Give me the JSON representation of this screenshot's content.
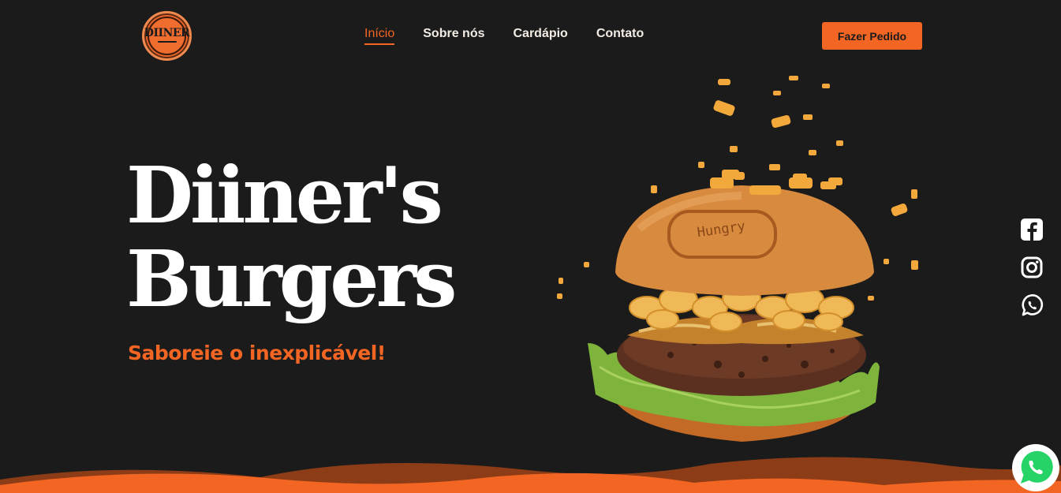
{
  "header": {
    "logo_text": "DIINER",
    "nav": [
      {
        "label": "Início",
        "active": true
      },
      {
        "label": "Sobre nós",
        "active": false
      },
      {
        "label": "Cardápio",
        "active": false
      },
      {
        "label": "Contato",
        "active": false
      }
    ],
    "cta_label": "Fazer Pedido"
  },
  "hero": {
    "title_line1": "Diiner's",
    "title_line2": "Burgers",
    "subtitle": "Saboreie o inexplicável!",
    "bun_stamp": "Hungry"
  },
  "social": [
    "facebook-icon",
    "instagram-icon",
    "whatsapp-icon"
  ],
  "floating": {
    "icon": "whatsapp-icon"
  },
  "colors": {
    "background": "#1c1b1c",
    "accent": "#f26522",
    "text": "#ffffff"
  }
}
